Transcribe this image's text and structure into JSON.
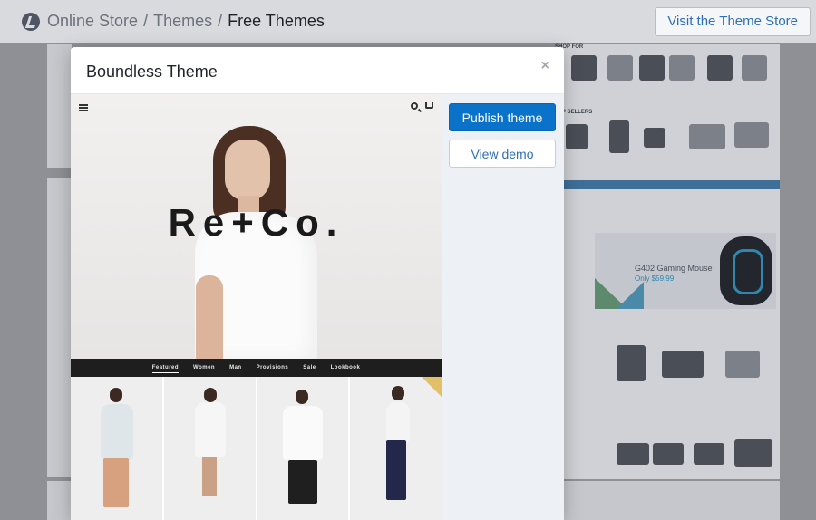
{
  "topbar": {
    "breadcrumb": [
      "Online Store",
      "Themes"
    ],
    "separator": "/",
    "current": "Free Themes",
    "visit_button": "Visit the Theme Store"
  },
  "modal": {
    "title": "Boundless Theme",
    "close_glyph": "×",
    "preview": {
      "brand": "Re+Co.",
      "nav_items": [
        "Featured",
        "Women",
        "Man",
        "Provisions",
        "Sale",
        "Lookbook"
      ],
      "active_nav": "Featured"
    },
    "actions": {
      "publish": "Publish theme",
      "demo": "View demo"
    }
  },
  "background": {
    "shop_for": "SHOP FOR",
    "sellers": "P SELLERS",
    "gaming_title": "G402 Gaming Mouse",
    "gaming_price": "Only $59.99"
  },
  "colors": {
    "primary": "#0a72c9",
    "link": "#2e6fb6"
  }
}
